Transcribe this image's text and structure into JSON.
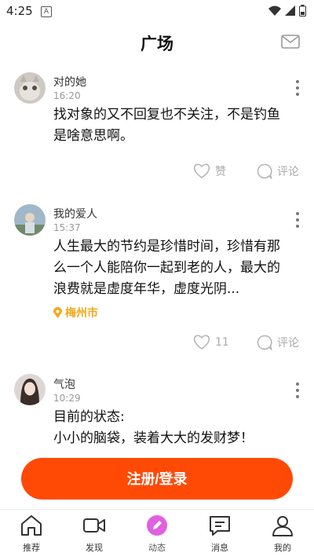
{
  "status_bar": {
    "time": "4:25",
    "notification_letter": "A"
  },
  "header": {
    "title": "广场"
  },
  "posts": [
    {
      "username": "对的她",
      "time": "16:20",
      "lines": [
        "找对象的又不回复也不关注，不是钓鱼",
        "是啥意思啊。"
      ],
      "like_label": "赞",
      "comment_label": "评论"
    },
    {
      "username": "我的爱人",
      "time": "15:37",
      "lines": [
        "人生最大的节约是珍惜时间，珍惜有那",
        "么一个人能陪你一起到老的人，最大的",
        "浪费就是虚度年华，虚度光阴..."
      ],
      "location": "梅州市",
      "like_label": "11",
      "comment_label": "评论"
    },
    {
      "username": "气泡",
      "time": "10:29",
      "lines": [
        "目前的状态:",
        "小小的脑袋，装着大大的发财梦！"
      ]
    }
  ],
  "cta": {
    "label": "注册/登录"
  },
  "tabbar": [
    {
      "label": "推荐",
      "icon": "home-icon"
    },
    {
      "label": "发现",
      "icon": "video-icon"
    },
    {
      "label": "动态",
      "icon": "pen-icon"
    },
    {
      "label": "消息",
      "icon": "message-icon"
    },
    {
      "label": "我的",
      "icon": "user-icon"
    }
  ],
  "colors": {
    "accent": "#ff4a05",
    "location": "#f3a81b",
    "active_tab": "#e060e0"
  }
}
